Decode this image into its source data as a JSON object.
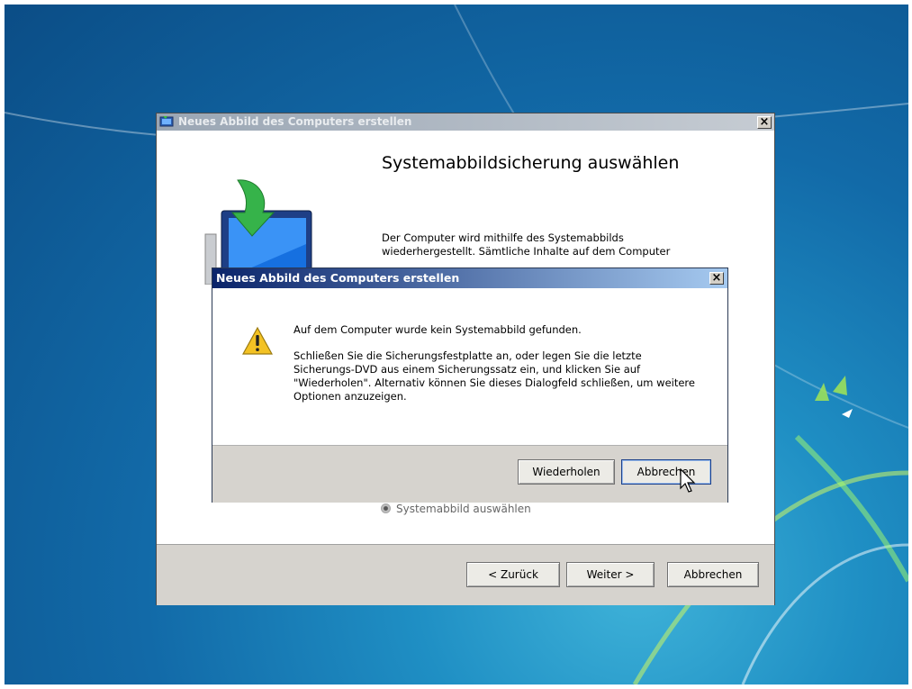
{
  "wizard": {
    "title": "Neues Abbild des Computers erstellen",
    "heading": "Systemabbildsicherung auswählen",
    "description": "Der Computer wird mithilfe des Systemabbilds wiederhergestellt. Sämtliche Inhalte auf dem Computer",
    "radio_label": "Systemabbild auswählen",
    "buttons": {
      "back": "< Zurück",
      "next": "Weiter >",
      "cancel": "Abbrechen"
    },
    "close_glyph": "×"
  },
  "dialog": {
    "title": "Neues Abbild des Computers erstellen",
    "message_main": "Auf dem Computer wurde kein Systemabbild gefunden.",
    "message_detail": "Schließen Sie die Sicherungsfestplatte an, oder legen Sie die letzte Sicherungs-DVD aus einem Sicherungssatz ein, und klicken Sie auf \"Wiederholen\". Alternativ können Sie dieses Dialogfeld schließen, um weitere Optionen anzuzeigen.",
    "buttons": {
      "retry": "Wiederholen",
      "cancel": "Abbrechen"
    },
    "close_glyph": "×",
    "icon": "warning-icon"
  },
  "colors": {
    "dialog_title_start": "#0a246a",
    "dialog_title_end": "#a6caf0",
    "desktop_blue": "#126aa8",
    "footer_gray": "#d6d3ce"
  }
}
